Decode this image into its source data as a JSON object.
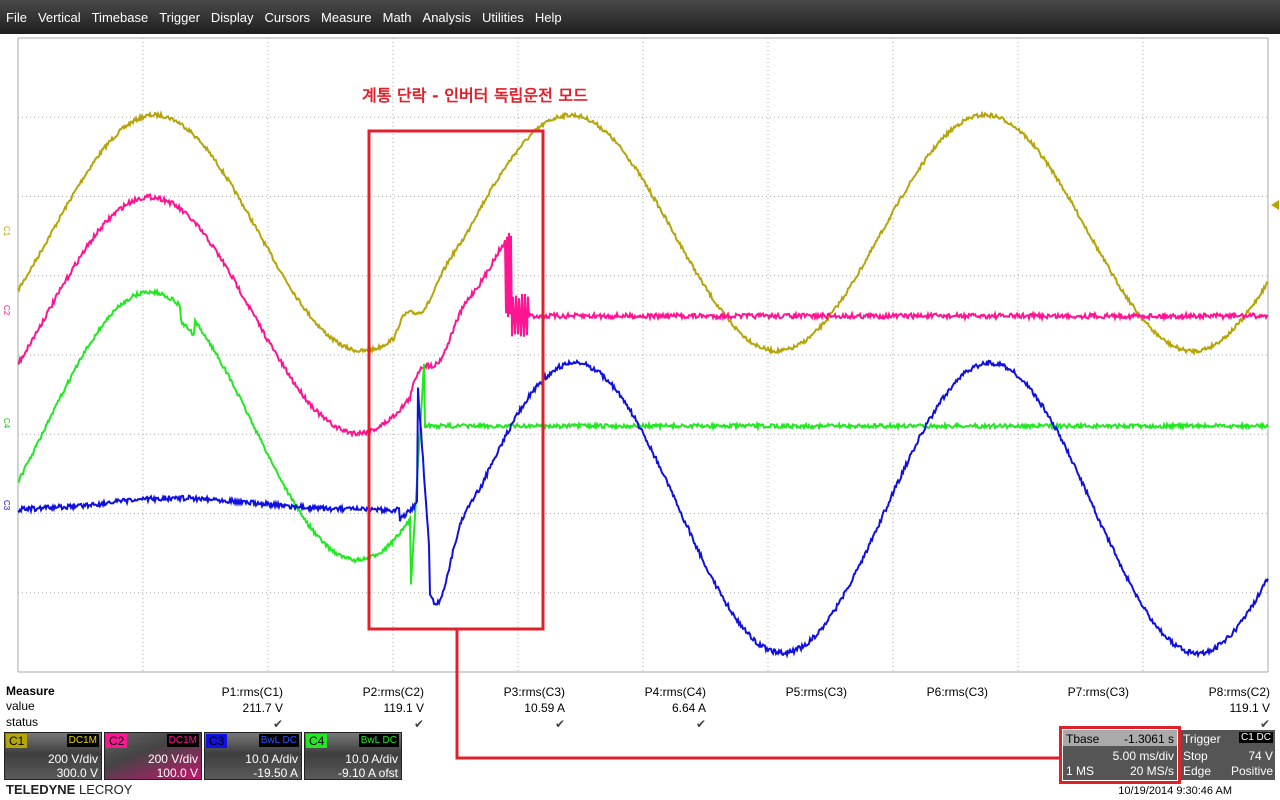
{
  "menu": [
    "File",
    "Vertical",
    "Timebase",
    "Trigger",
    "Display",
    "Cursors",
    "Measure",
    "Math",
    "Analysis",
    "Utilities",
    "Help"
  ],
  "annotation": "계통 단락 - 인버터 독립운전 모드",
  "channel_markers": [
    "C1",
    "C2",
    "C4",
    "C3"
  ],
  "colors": {
    "C1": "#b5a50a",
    "C2": "#ff1493",
    "C3": "#1010e0",
    "C4": "#22e822",
    "annotation": "#e0202a"
  },
  "measure": {
    "title": "Measure",
    "row_value": "value",
    "row_status": "status",
    "params": [
      {
        "name": "P1:rms(C1)",
        "value": "211.7 V",
        "status": "✔"
      },
      {
        "name": "P2:rms(C2)",
        "value": "119.1 V",
        "status": "✔"
      },
      {
        "name": "P3:rms(C3)",
        "value": "10.59 A",
        "status": "✔"
      },
      {
        "name": "P4:rms(C4)",
        "value": "6.64 A",
        "status": "✔"
      },
      {
        "name": "P5:rms(C3)",
        "value": "",
        "status": ""
      },
      {
        "name": "P6:rms(C3)",
        "value": "",
        "status": ""
      },
      {
        "name": "P7:rms(C3)",
        "value": "",
        "status": ""
      },
      {
        "name": "P8:rms(C2)",
        "value": "119.1 V",
        "status": "✔"
      }
    ]
  },
  "channels": [
    {
      "label": "C1",
      "coupling": "DC1M",
      "scale": "200 V/div",
      "offset": "300.0 V"
    },
    {
      "label": "C2",
      "coupling": "DC1M",
      "scale": "200 V/div",
      "offset": "100.0 V"
    },
    {
      "label": "C3",
      "coupling": "BwL DC",
      "scale": "10.0 A/div",
      "offset": "-19.50 A"
    },
    {
      "label": "C4",
      "coupling": "BwL DC",
      "scale": "10.0 A/div",
      "offset": "-9.10 A ofst"
    }
  ],
  "timebase": {
    "label": "Tbase",
    "delay": "-1.3061 s",
    "scale": "5.00 ms/div",
    "samples": "1 MS",
    "rate": "20 MS/s"
  },
  "trigger": {
    "label": "Trigger",
    "source": "C1 DC",
    "mode": "Stop",
    "level": "74 V",
    "type": "Edge",
    "slope": "Positive"
  },
  "brand": {
    "a": "TELEDYNE",
    "b": "LECROY"
  },
  "datetime": "10/19/2014 9:30:46 AM"
}
